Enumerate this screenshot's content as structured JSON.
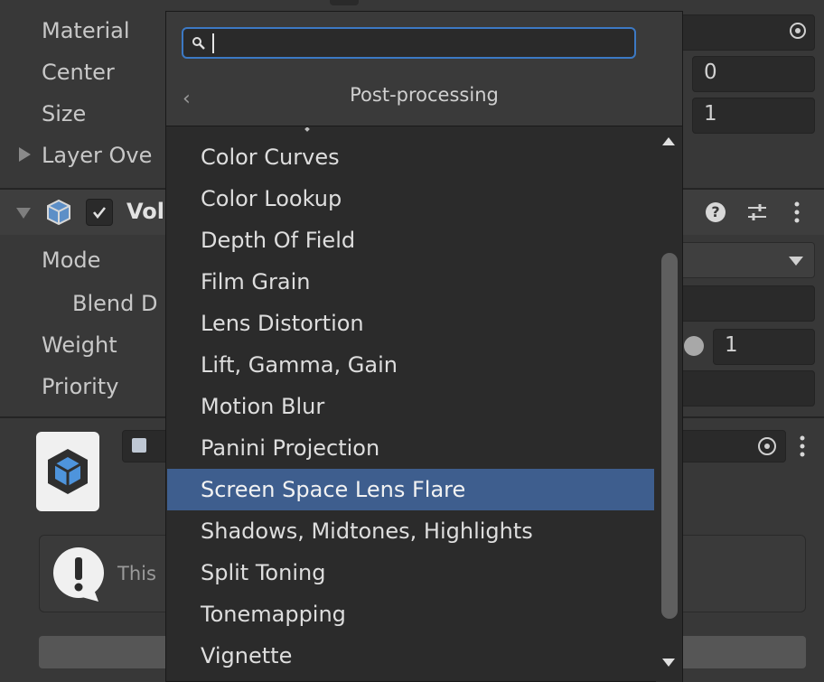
{
  "inspector": {
    "material_label": "Material",
    "center_label": "Center",
    "center_value": "0",
    "size_label": "Size",
    "size_value": "1",
    "layer_overrides_label": "Layer Ove",
    "volume_component_label": "Vol",
    "mode_label": "Mode",
    "blend_label": "Blend D",
    "weight_label": "Weight",
    "weight_value": "1",
    "priority_label": "Priority",
    "info_text": "This",
    "icons": {
      "material_picker": "object-picker-icon",
      "volume_help": "help-icon",
      "volume_presets": "presets-icon",
      "volume_menu": "kebab-menu-icon",
      "profile_picker": "object-picker-icon",
      "info": "info-exclamation-icon"
    }
  },
  "popup": {
    "search_value": "",
    "title": "Post-processing",
    "back_icon": "chevron-left-icon",
    "items": [
      "Color Curves",
      "Color Lookup",
      "Depth Of Field",
      "Film Grain",
      "Lens Distortion",
      "Lift, Gamma, Gain",
      "Motion Blur",
      "Panini Projection",
      "Screen Space Lens Flare",
      "Shadows, Midtones, Highlights",
      "Split Toning",
      "Tonemapping",
      "Vignette"
    ],
    "selected_item": "Screen Space Lens Flare"
  },
  "colors": {
    "background": "#383838",
    "field": "#2a2a2a",
    "popup": "#2b2b2b",
    "selection": "#3e5e8e",
    "search_border": "#3c79c4"
  }
}
